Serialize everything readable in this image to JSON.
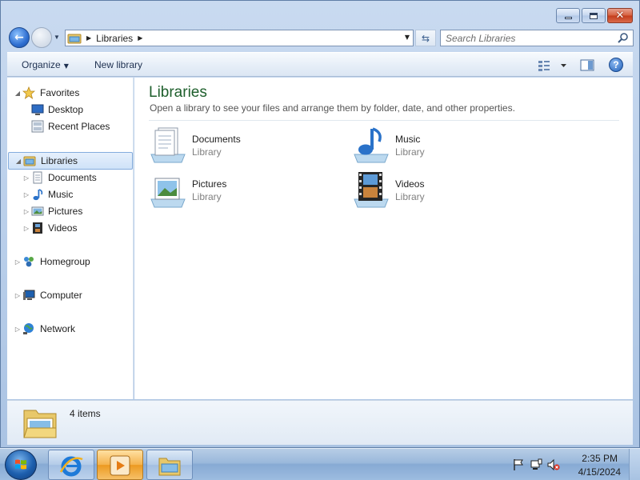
{
  "window": {
    "controls": {
      "minimize": "minimize",
      "maximize": "maximize",
      "close": "✕"
    }
  },
  "address_bar": {
    "breadcrumb": [
      "Libraries"
    ],
    "search_placeholder": "Search Libraries"
  },
  "command_bar": {
    "organize_label": "Organize",
    "new_library_label": "New library"
  },
  "nav_tree": {
    "favorites": {
      "label": "Favorites",
      "children": [
        "Desktop",
        "Recent Places"
      ]
    },
    "libraries": {
      "label": "Libraries",
      "children": [
        "Documents",
        "Music",
        "Pictures",
        "Videos"
      ]
    },
    "homegroup": "Homegroup",
    "computer": "Computer",
    "network": "Network"
  },
  "content": {
    "title": "Libraries",
    "subtitle": "Open a library to see your files and arrange them by folder, date, and other properties.",
    "libraries": [
      {
        "name": "Documents",
        "type": "Library",
        "icon": "documents-library-icon"
      },
      {
        "name": "Music",
        "type": "Library",
        "icon": "music-library-icon"
      },
      {
        "name": "Pictures",
        "type": "Library",
        "icon": "pictures-library-icon"
      },
      {
        "name": "Videos",
        "type": "Library",
        "icon": "videos-library-icon"
      }
    ]
  },
  "details": {
    "item_count": "4 items"
  },
  "taskbar": {
    "apps": [
      "internet-explorer",
      "windows-media-player",
      "windows-explorer"
    ],
    "clock": {
      "time": "2:35 PM",
      "date": "4/15/2024"
    }
  },
  "colors": {
    "title_green": "#1e5f2c",
    "selection_blue": "#cfe2f8",
    "taskbar_blue": "#9ab8db"
  }
}
